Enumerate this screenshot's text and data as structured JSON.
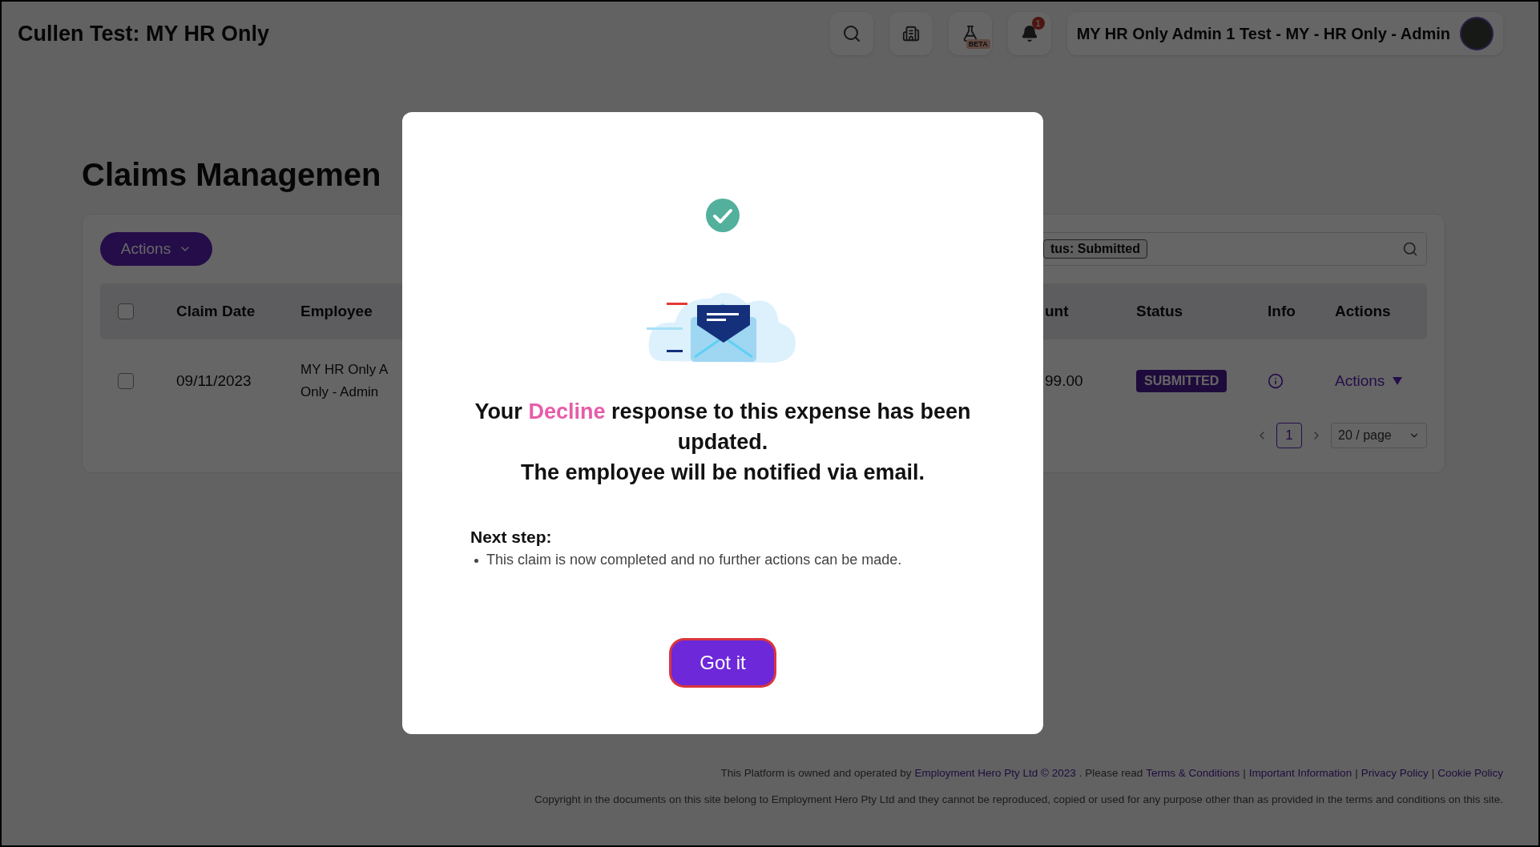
{
  "header": {
    "title": "Cullen Test: MY HR Only",
    "beta_badge": "BETA",
    "notification_count": "1",
    "user_name": "MY HR Only Admin 1 Test - MY - HR Only - Admin"
  },
  "page": {
    "title": "Claims Managemen"
  },
  "toolbar": {
    "actions_button": "Actions",
    "filter_tag": "tus: Submitted"
  },
  "table": {
    "header_checkbox": {
      "checked": false
    },
    "columns": [
      "Claim Date",
      "Employee",
      "unt",
      "Status",
      "Info",
      "Actions"
    ],
    "rows": [
      {
        "checked": false,
        "claim_date": "09/11/2023",
        "employee": [
          "MY HR Only A",
          "Only - Admin"
        ],
        "amount": "99.00",
        "status": "SUBMITTED",
        "actions": "Actions"
      }
    ]
  },
  "pagination": {
    "pages": [
      {
        "label": "1",
        "selected": true
      }
    ],
    "page_size": "20 / page"
  },
  "modal": {
    "message": {
      "before": "Your",
      "highlight": "Decline",
      "after": "response to this expense has been updated."
    },
    "note": "The employee will be notified via email.",
    "next_step": {
      "title": "Next step:",
      "items": [
        "This claim is now completed and no further actions can be made."
      ]
    },
    "button": {
      "label": "Got it",
      "focused": true
    }
  },
  "footer": {
    "notice": [
      {
        "kind": "text",
        "text": "This Platform is owned and operated by"
      },
      {
        "kind": "link",
        "text": "Employment Hero Pty Ltd © 2023"
      },
      {
        "kind": "text",
        "text": ". Please read"
      },
      {
        "kind": "link",
        "text": "Terms & Conditions"
      },
      {
        "kind": "separator",
        "text": "|"
      },
      {
        "kind": "link",
        "text": "Important Information"
      },
      {
        "kind": "separator",
        "text": "|"
      },
      {
        "kind": "link",
        "text": "Privacy Policy"
      },
      {
        "kind": "separator",
        "text": "|"
      },
      {
        "kind": "link",
        "text": "Cookie Policy"
      }
    ],
    "copyright": "Copyright in the documents on this site belong to Employment Hero Pty Ltd and they cannot be reproduced, copied or used for any purpose other than as provided in the terms and conditions on this site."
  }
}
